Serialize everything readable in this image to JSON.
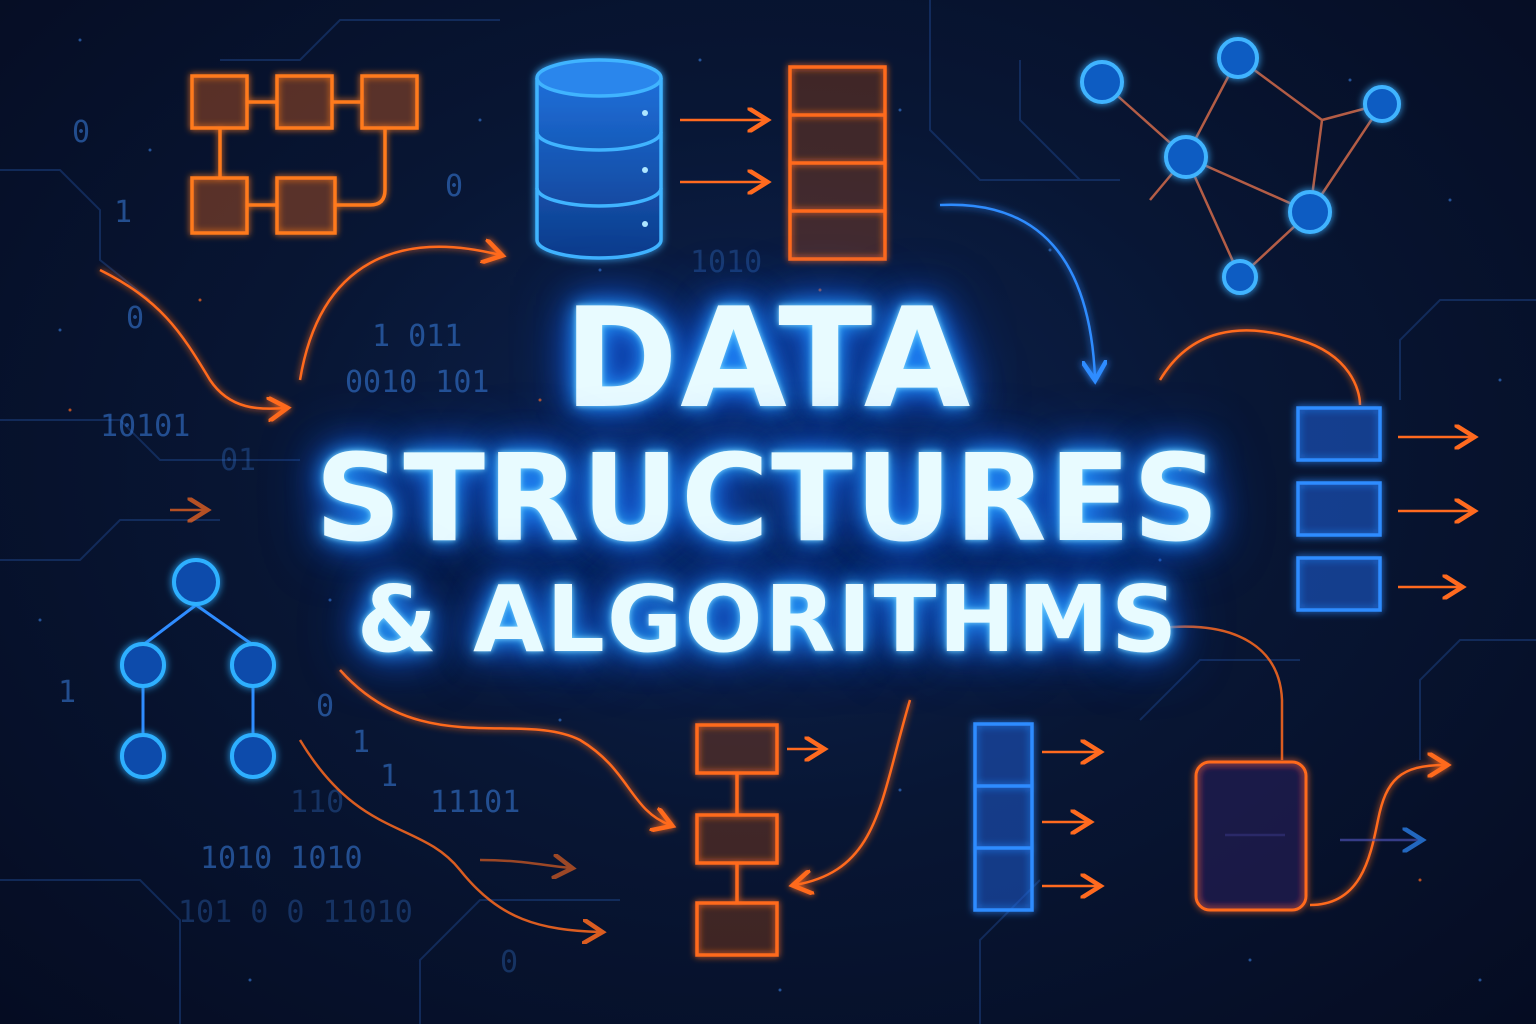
{
  "title": {
    "line1": "DATA",
    "line2": "STRUCTURES",
    "line3": "& ALGORITHMS"
  },
  "binary_snippets": [
    "0",
    "1",
    "0",
    "0",
    "1 011",
    "0010 101",
    "10101",
    "01",
    "1010",
    "1",
    "0",
    "1",
    "1",
    "110",
    "11101",
    "1010 1010",
    "101 0 0 11010",
    "0"
  ],
  "colors": {
    "background": "#081634",
    "accent_blue": "#2aa8ff",
    "accent_orange": "#ff6a1f",
    "title_text": "#e8fbff"
  },
  "icons": [
    "linked-list-grid-icon",
    "database-cylinder-icon",
    "stack-array-icon",
    "graph-network-icon",
    "queue-icon",
    "binary-tree-icon",
    "flowchart-icon",
    "vertical-array-icon",
    "container-box-icon"
  ]
}
